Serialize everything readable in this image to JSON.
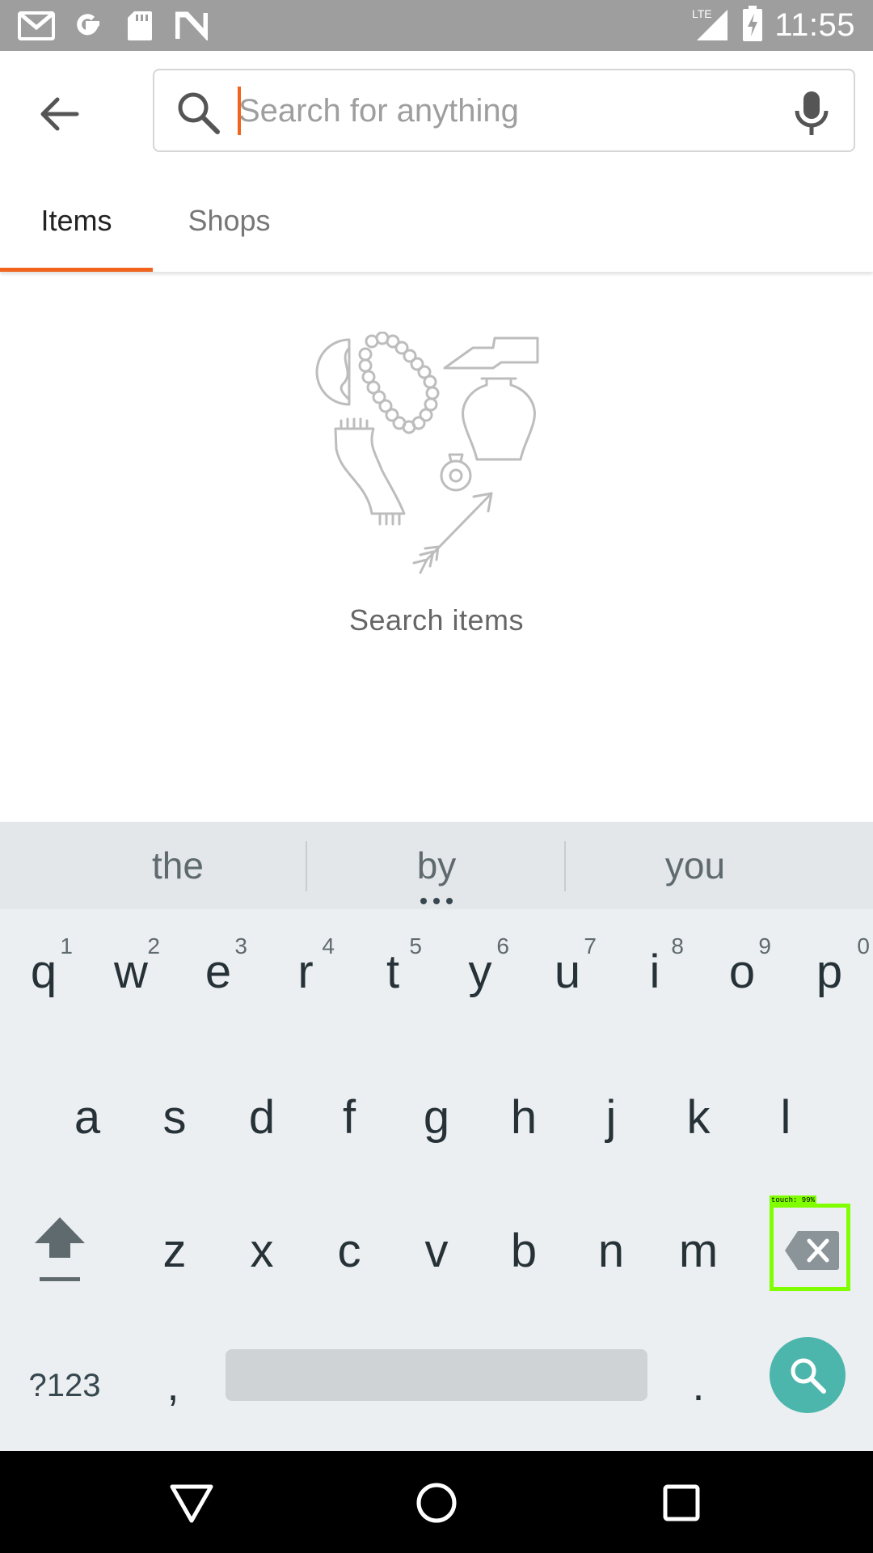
{
  "status_bar": {
    "time": "11:55",
    "network_label": "LTE",
    "left_icons": [
      "gmail-icon",
      "google-icon",
      "sd-card-icon",
      "n-icon"
    ]
  },
  "search": {
    "placeholder": "Search for anything",
    "value": ""
  },
  "tabs": [
    {
      "label": "Items",
      "active": true
    },
    {
      "label": "Shops",
      "active": false
    }
  ],
  "empty_state": {
    "text": "Search items"
  },
  "keyboard": {
    "suggestions": [
      "the",
      "by",
      "you"
    ],
    "row1": [
      {
        "key": "q",
        "hint": "1"
      },
      {
        "key": "w",
        "hint": "2"
      },
      {
        "key": "e",
        "hint": "3"
      },
      {
        "key": "r",
        "hint": "4"
      },
      {
        "key": "t",
        "hint": "5"
      },
      {
        "key": "y",
        "hint": "6"
      },
      {
        "key": "u",
        "hint": "7"
      },
      {
        "key": "i",
        "hint": "8"
      },
      {
        "key": "o",
        "hint": "9"
      },
      {
        "key": "p",
        "hint": "0"
      }
    ],
    "row2": [
      "a",
      "s",
      "d",
      "f",
      "g",
      "h",
      "j",
      "k",
      "l"
    ],
    "row3": [
      "z",
      "x",
      "c",
      "v",
      "b",
      "n",
      "m"
    ],
    "symbols_label": "?123",
    "comma": ",",
    "period": ".",
    "touch_label": "touch: 99%"
  },
  "colors": {
    "accent": "#f1641e",
    "enter_key": "#4db6ac",
    "touch_highlight": "#7fff00"
  }
}
